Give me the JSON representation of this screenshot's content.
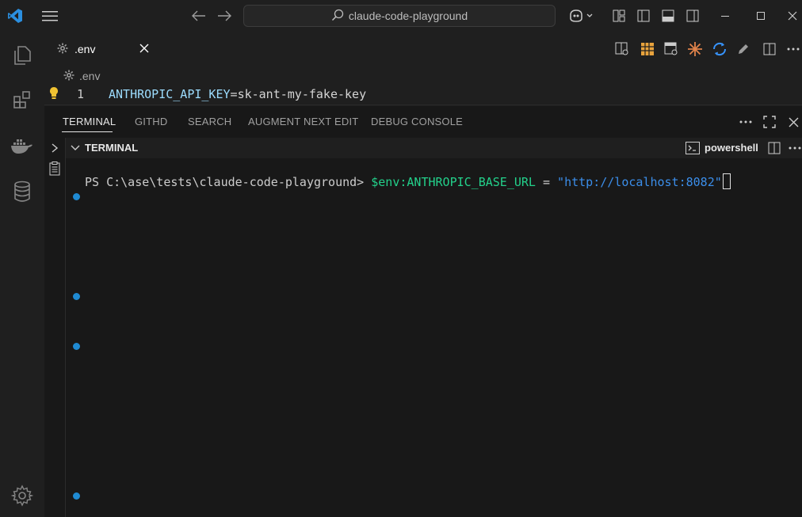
{
  "search": {
    "text": "claude-code-playground"
  },
  "editor": {
    "tab_label": ".env",
    "breadcrumb": ".env",
    "line_number": "1",
    "line_key": "ANTHROPIC_API_KEY",
    "line_eq": "=",
    "line_value": "sk-ant-my-fake-key"
  },
  "panel": {
    "tabs": [
      {
        "label": "TERMINAL"
      },
      {
        "label": "GITHD"
      },
      {
        "label": "SEARCH"
      },
      {
        "label": "AUGMENT NEXT EDIT"
      },
      {
        "label": "DEBUG CONSOLE"
      }
    ]
  },
  "terminal": {
    "header_title": "TERMINAL",
    "shell_name": "powershell",
    "prompt": "PS C:\\ase\\tests\\claude-code-playground> ",
    "cmd_var": "$env:ANTHROPIC_BASE_URL",
    "cmd_op": " = ",
    "cmd_value": "\"http://localhost:8082\""
  },
  "colors": {
    "accent": "#0078d4",
    "dot": "#1f8ad2",
    "var_green": "#23d18b",
    "string_blue": "#3b8eea",
    "key_blue": "#9cdcfe"
  }
}
